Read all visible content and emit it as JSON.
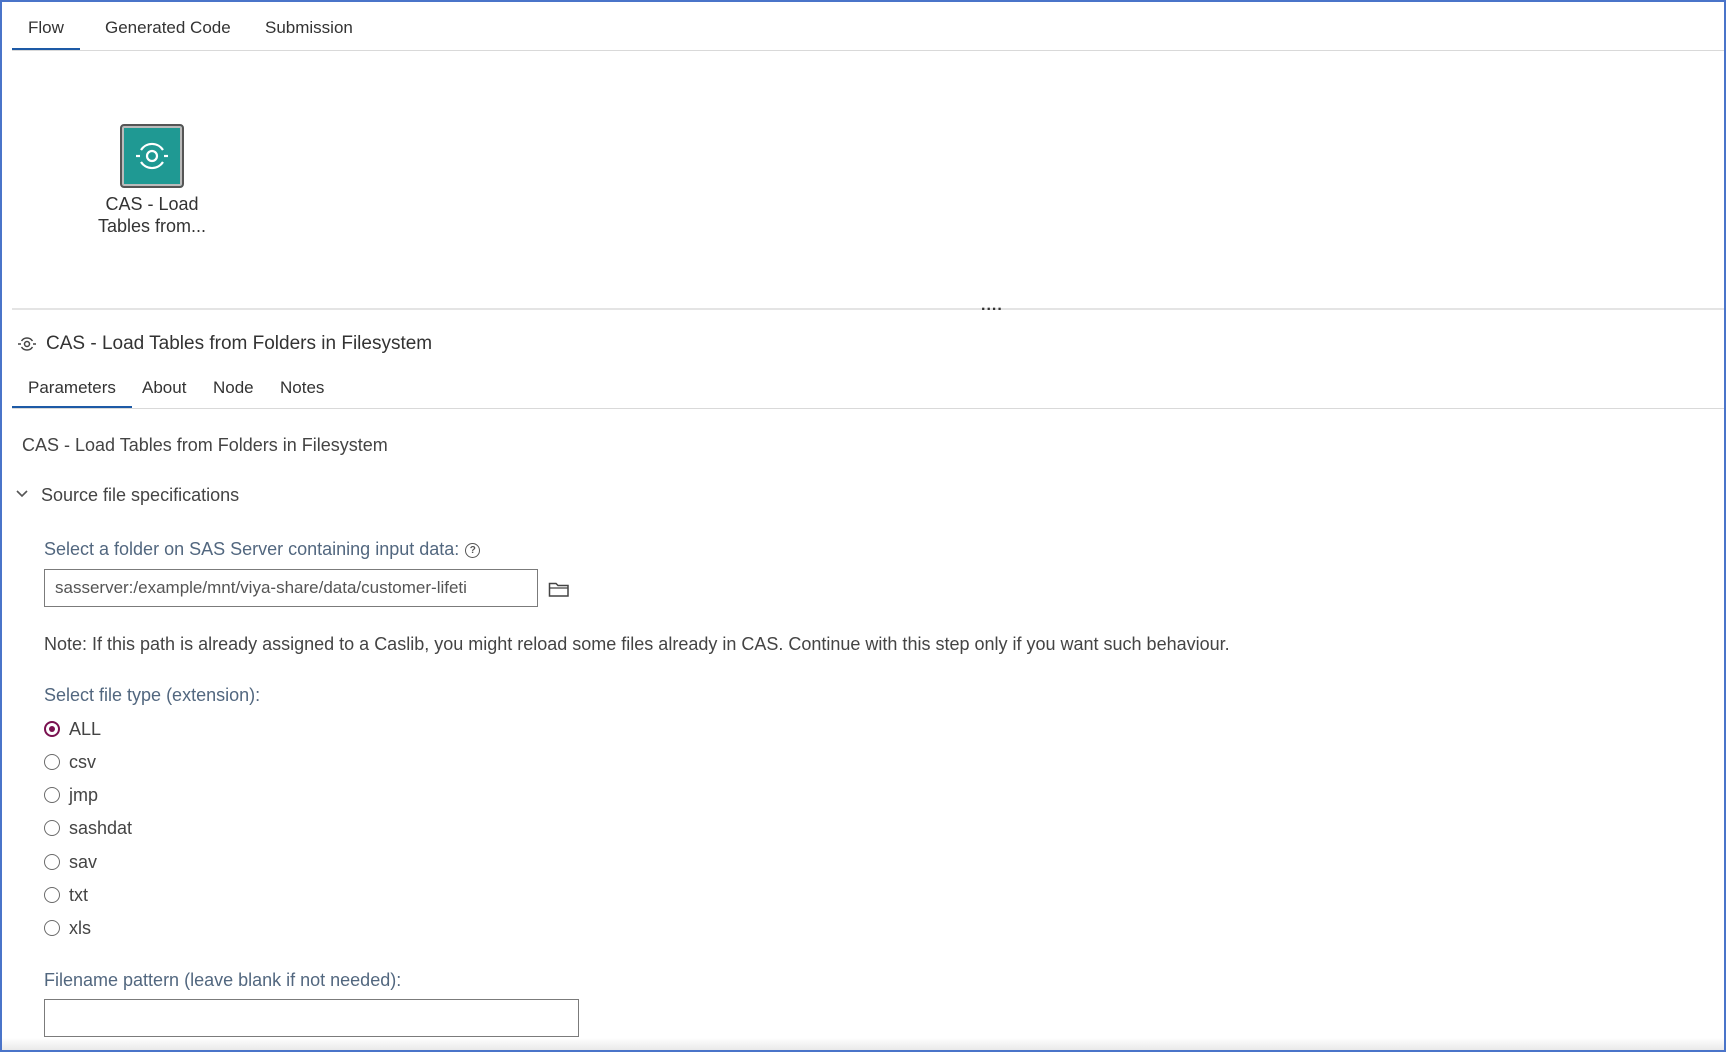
{
  "top_tabs": [
    "Flow",
    "Generated Code",
    "Submission"
  ],
  "active_top_tab": "Flow",
  "canvas": {
    "node_label_line1": "CAS - Load",
    "node_label_line2": "Tables from...",
    "node_icon": "cas-load-icon",
    "node_color": "#1f9993"
  },
  "splitter_grip": "....",
  "step": {
    "title": "CAS - Load Tables from Folders in Filesystem",
    "icon": "cas-load-icon"
  },
  "sub_tabs": [
    "Parameters",
    "About",
    "Node",
    "Notes"
  ],
  "active_sub_tab": "Parameters",
  "form": {
    "title": "CAS - Load Tables from Folders in Filesystem",
    "section_label": "Source file specifications",
    "folder_label": "Select a folder on SAS Server containing input data:",
    "folder_value": "sasserver:/example/mnt/viya-share/data/customer-lifeti",
    "note": "Note: If this path is already assigned to a Caslib, you might reload some files already in CAS. Continue with this step only if you want such behaviour.",
    "filetype_label": "Select file type (extension):",
    "filetypes": [
      "ALL",
      "csv",
      "jmp",
      "sashdat",
      "sav",
      "txt",
      "xls"
    ],
    "selected_filetype": "ALL",
    "pattern_label": "Filename pattern (leave blank if not needed):",
    "pattern_value": ""
  },
  "colors": {
    "accent": "#7a1150",
    "tab_underline": "#1d5aa6",
    "label": "#52677f",
    "frame_border": "#4a74c9"
  }
}
